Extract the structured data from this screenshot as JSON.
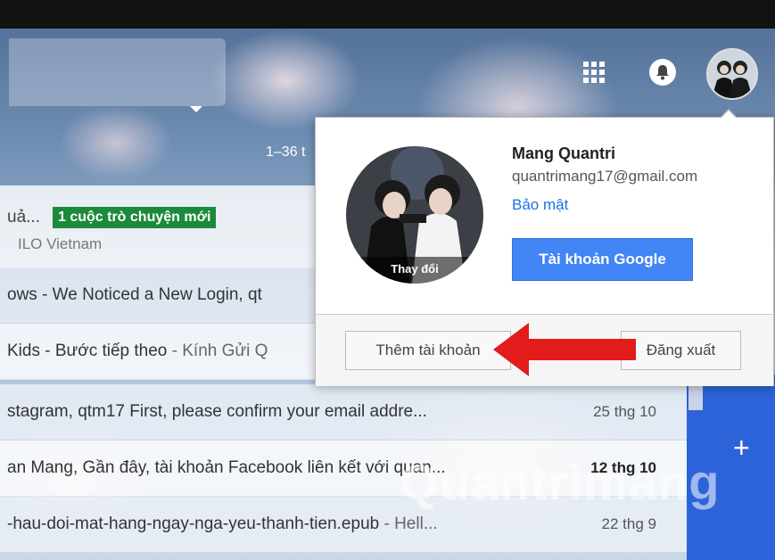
{
  "toolbar": {
    "apps_icon": "apps-grid-icon",
    "notifications_icon": "bell-icon",
    "avatar_icon": "account-avatar"
  },
  "pagination": {
    "range_text": "1–36 t"
  },
  "emails": [
    {
      "text": "uả...",
      "chip": "1 cuộc trò chuyện mới",
      "sender": "ILO Vietnam",
      "date": ""
    },
    {
      "subject": "ows - We Noticed a New Login, qt",
      "snippet": "",
      "date": ""
    },
    {
      "subject": "Kids - Bước tiếp theo",
      "snippet": " - Kính Gửi Q",
      "date": ""
    },
    {
      "subject": "stagram, qtm17 First, please confirm your email addre...",
      "snippet": "",
      "date": "25 thg 10"
    },
    {
      "subject": "an Mang, Gần đây, tài khoản Facebook liên kết với quan...",
      "snippet": "",
      "date": "12 thg 10"
    },
    {
      "subject": "-hau-doi-mat-hang-ngay-nga-yeu-thanh-tien.epub",
      "snippet": " - Hell...",
      "date": "22 thg 9"
    }
  ],
  "account_popup": {
    "name": "Mang Quantri",
    "email": "quantrimang17@gmail.com",
    "security_link": "Bảo mật",
    "google_account_button": "Tài khoản Google",
    "change_photo_label": "Thay đổi",
    "add_account_button": "Thêm tài khoản",
    "sign_out_button": "Đăng xuất"
  },
  "compose": {
    "plus_label": "+"
  },
  "watermark": "Quantrimang",
  "colors": {
    "accent_blue": "#4285f4",
    "chip_green": "#1b8a3a",
    "annotation_arrow": "#e21b1b"
  }
}
